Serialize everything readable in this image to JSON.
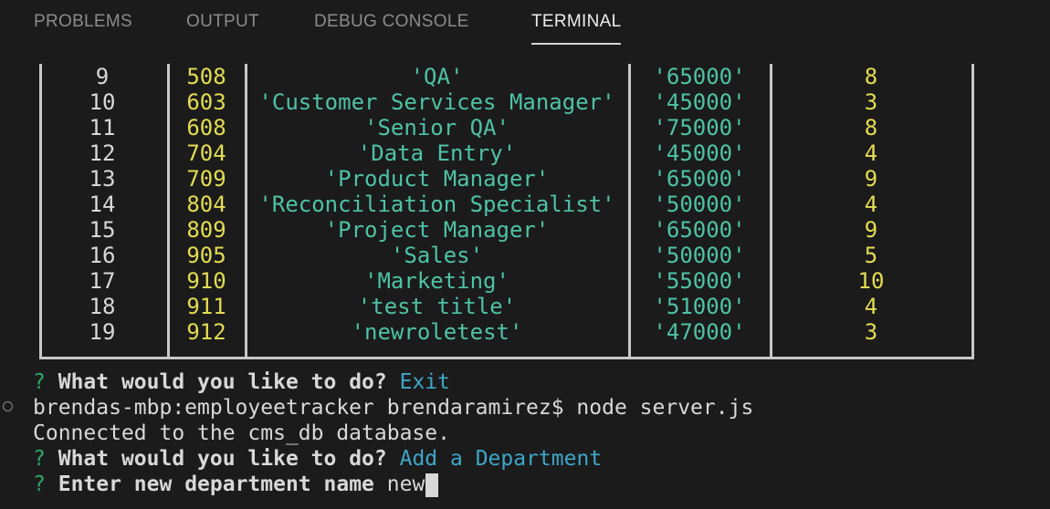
{
  "tabs": [
    {
      "label": "PROBLEMS"
    },
    {
      "label": "OUTPUT"
    },
    {
      "label": "DEBUG CONSOLE"
    },
    {
      "label": "TERMINAL"
    }
  ],
  "table_rows": [
    {
      "index": "9",
      "id": "508",
      "title": "'QA'",
      "salary": "'65000'",
      "department_id": "8"
    },
    {
      "index": "10",
      "id": "603",
      "title": "'Customer Services Manager'",
      "salary": "'45000'",
      "department_id": "3"
    },
    {
      "index": "11",
      "id": "608",
      "title": "'Senior QA'",
      "salary": "'75000'",
      "department_id": "8"
    },
    {
      "index": "12",
      "id": "704",
      "title": "'Data Entry'",
      "salary": "'45000'",
      "department_id": "4"
    },
    {
      "index": "13",
      "id": "709",
      "title": "'Product Manager'",
      "salary": "'65000'",
      "department_id": "9"
    },
    {
      "index": "14",
      "id": "804",
      "title": "'Reconciliation Specialist'",
      "salary": "'50000'",
      "department_id": "4"
    },
    {
      "index": "15",
      "id": "809",
      "title": "'Project Manager'",
      "salary": "'65000'",
      "department_id": "9"
    },
    {
      "index": "16",
      "id": "905",
      "title": "'Sales'",
      "salary": "'50000'",
      "department_id": "5"
    },
    {
      "index": "17",
      "id": "910",
      "title": "'Marketing'",
      "salary": "'55000'",
      "department_id": "10"
    },
    {
      "index": "18",
      "id": "911",
      "title": "'test title'",
      "salary": "'51000'",
      "department_id": "4"
    },
    {
      "index": "19",
      "id": "912",
      "title": "'newroletest'",
      "salary": "'47000'",
      "department_id": "3"
    }
  ],
  "terminal": {
    "prompt_mark": "?",
    "q1_text": "What would you like to do?",
    "q1_answer": "Exit",
    "shell_prompt": "brendas-mbp:employeetracker brendaramirez$ node server.js",
    "connected_msg": "Connected to the cms_db database.",
    "q2_text": "What would you like to do?",
    "q2_answer": "Add a Department",
    "q3_text": "Enter new department name",
    "q3_input": "new"
  },
  "colors": {
    "background": "#1b1b1b",
    "yellow_values": "#e3dc52",
    "teal_values": "#4ec2a5",
    "answer_blue": "#3ea6c8",
    "prompt_green": "#2ea66a"
  }
}
